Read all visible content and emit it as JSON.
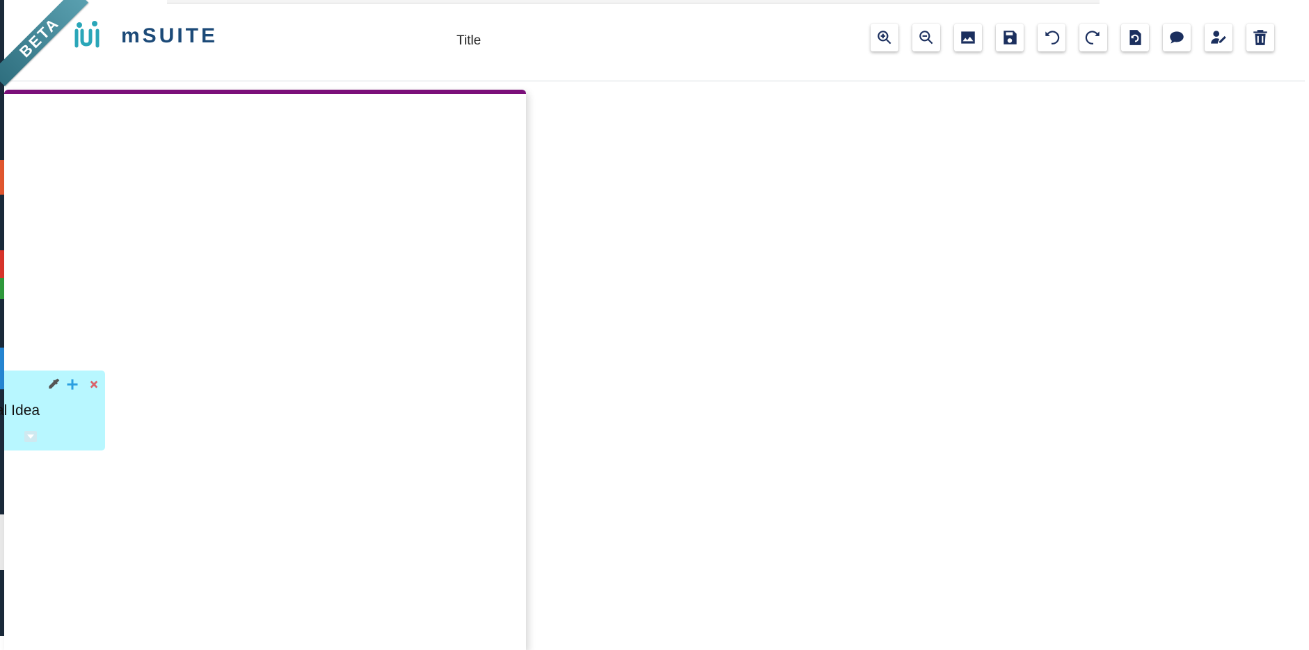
{
  "app": {
    "brand": "mSUITE",
    "beta_label": "BETA"
  },
  "header": {
    "title": "Title"
  },
  "toolbar": {
    "buttons": [
      {
        "name": "zoom-in-button",
        "icon": "zoom-in-icon"
      },
      {
        "name": "zoom-out-button",
        "icon": "zoom-out-icon"
      },
      {
        "name": "image-button",
        "icon": "image-icon"
      },
      {
        "name": "save-button",
        "icon": "save-icon"
      },
      {
        "name": "undo-button",
        "icon": "undo-icon"
      },
      {
        "name": "redo-button",
        "icon": "redo-icon"
      },
      {
        "name": "restore-button",
        "icon": "file-restore-icon"
      },
      {
        "name": "comment-button",
        "icon": "comment-icon"
      },
      {
        "name": "edit-user-button",
        "icon": "user-edit-icon"
      },
      {
        "name": "delete-button",
        "icon": "trash-icon"
      }
    ]
  },
  "canvas": {
    "node": {
      "text": "al Idea",
      "color": "#b8f7ff"
    }
  },
  "colors": {
    "accent": "#7b0f7a",
    "icon": "#1b2f5e",
    "brand": "#1c4a78",
    "logo_teal": "#2aa6b8"
  }
}
